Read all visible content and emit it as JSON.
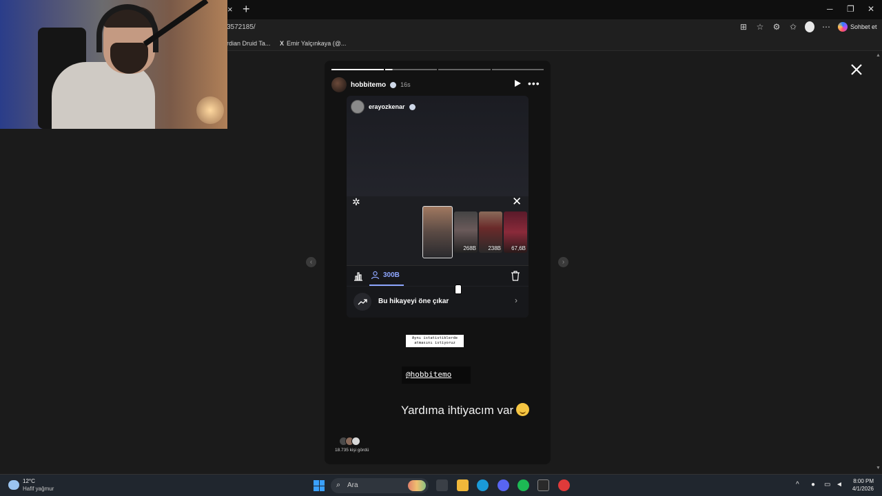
{
  "browser": {
    "url_fragment": "3572185/",
    "bookmarks": [
      "rdian Druid Ta...",
      "Emir Yalçınkaya (@..."
    ],
    "copilot_label": "Sohbet et",
    "tab_close": "×",
    "new_tab": "+"
  },
  "story": {
    "username": "hobbitemo",
    "time_ago": "16s",
    "segments": 4,
    "inner": {
      "username": "erayozkenar",
      "thumbnails": [
        {
          "label": ""
        },
        {
          "label": "268B"
        },
        {
          "label": "238B"
        },
        {
          "label": "67,6B"
        }
      ],
      "viewers_count": "300B",
      "promote_label": "Bu hikayeyi öne çıkar"
    },
    "sticker_text": "Aynı istatistiklerde atmasını istiyoruz",
    "mention": "@hobbitemo",
    "caption": "Yardıma ihtiyacım var",
    "seen_by": "18.735 kişi gördü"
  },
  "taskbar": {
    "weather_temp": "12°C",
    "weather_desc": "Hafif yağmur",
    "search_placeholder": "Ara",
    "time": "8:00 PM",
    "date": "4/1/2026"
  },
  "colors": {
    "accent_blue": "#8ea6ff",
    "windows_blue": "#3aa0ff"
  }
}
